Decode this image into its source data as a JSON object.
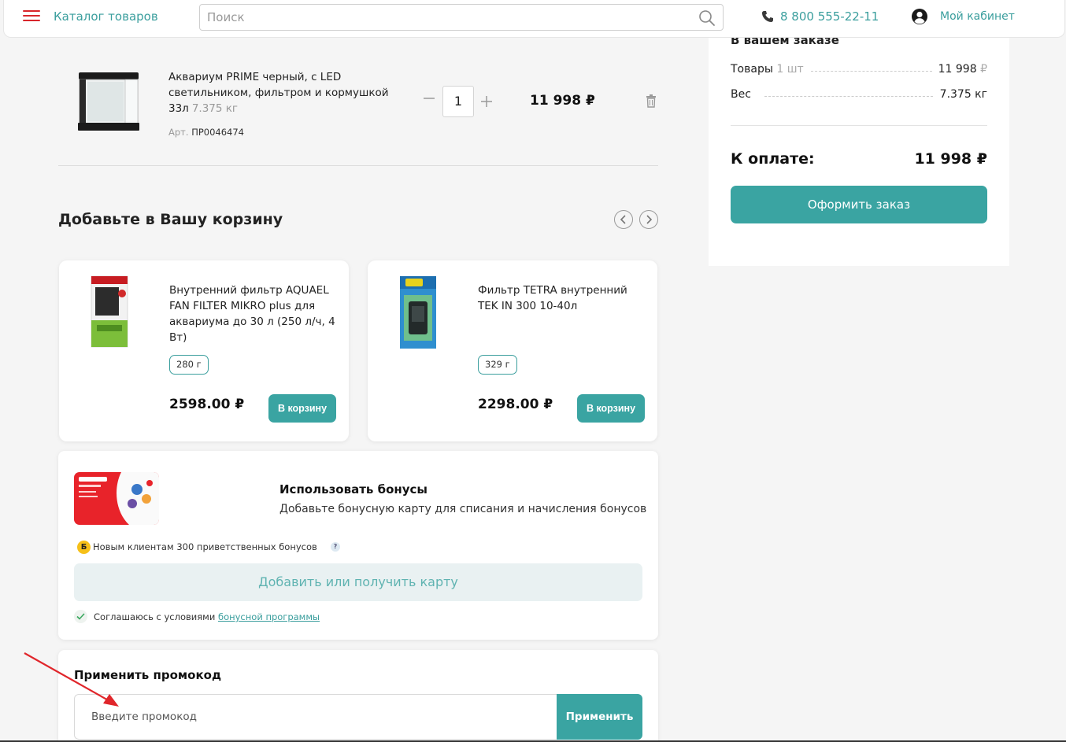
{
  "header": {
    "catalog_label": "Каталог товаров",
    "search_placeholder": "Поиск",
    "phone": "8 800 555-22-11",
    "cabinet_label": "Мой кабинет"
  },
  "cart_item": {
    "name": "Аквариум PRIME черный, с LED светильником, фильтром и кормушкой 33л",
    "weight": "7.375 кг",
    "art_label": "Арт.",
    "art": "ПР0046474",
    "qty": "1",
    "price": "11 998 ₽"
  },
  "upsell": {
    "title": "Добавьте в Вашу корзину",
    "products": [
      {
        "name": "Внутренний фильтр AQUAEL FAN FILTER MIKRO plus для аквариума до 30 л (250 л/ч, 4 Вт)",
        "weight": "280 г",
        "price": "2598.00 ₽",
        "button": "В корзину"
      },
      {
        "name": "Фильтр TETRA внутренний TEK IN 300 10-40л",
        "weight": "329 г",
        "price": "2298.00 ₽",
        "button": "В корзину"
      }
    ]
  },
  "bonus": {
    "title": "Использовать бонусы",
    "subtitle": "Добавьте бонусную карту для списания и начисления бонусов",
    "coin_letter": "Б",
    "new_clients": "Новым клиентам 300 приветственных бонусов",
    "help": "?",
    "add_card": "Добавить или получить карту",
    "agree_text": "Соглашаюсь с условиями",
    "agree_link": "бонусной программы"
  },
  "promo": {
    "title": "Применить промокод",
    "placeholder": "Введите промокод",
    "button": "Применить"
  },
  "summary": {
    "title": "В вашем заказе",
    "goods_label": "Товары",
    "goods_count": "1 шт",
    "goods_value": "11 998",
    "currency": "₽",
    "weight_label": "Вес",
    "weight_value": "7.375 кг",
    "pay_label": "К оплате:",
    "pay_value": "11 998 ₽",
    "order_button": "Оформить заказ"
  },
  "colors": {
    "accent": "#3aa4a2",
    "brand_red": "#d8262b",
    "link": "#3a9e9d"
  }
}
